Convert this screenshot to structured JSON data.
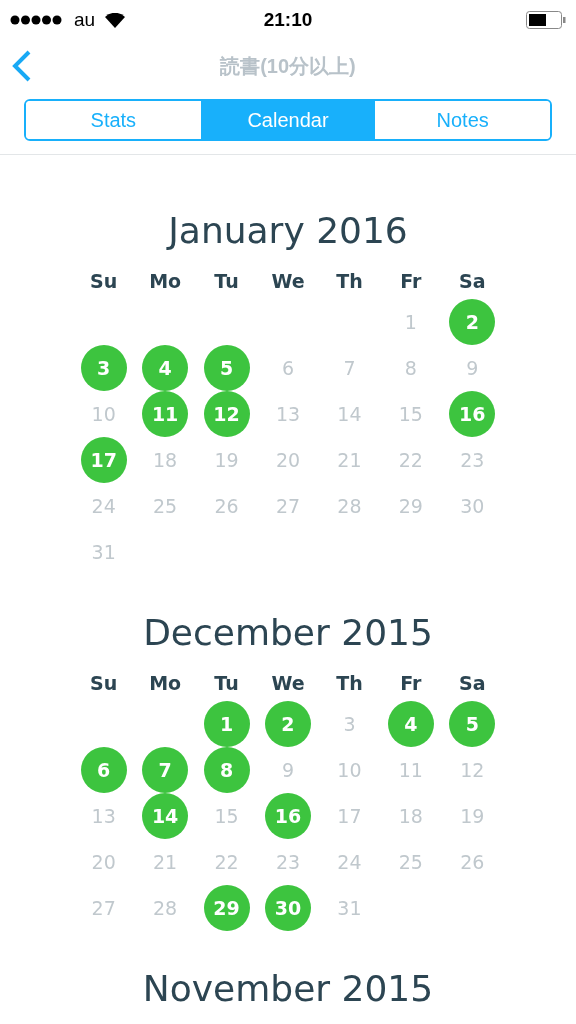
{
  "status_bar": {
    "carrier": "au",
    "time": "21:10"
  },
  "nav": {
    "title": "読書(10分以上)"
  },
  "tabs": [
    {
      "label": "Stats",
      "selected": false
    },
    {
      "label": "Calendar",
      "selected": true
    },
    {
      "label": "Notes",
      "selected": false
    }
  ],
  "months": [
    {
      "title": "January 2016",
      "weekdays": [
        "Su",
        "Mo",
        "Tu",
        "We",
        "Th",
        "Fr",
        "Sa"
      ],
      "days": [
        {
          "kind": "blank"
        },
        {
          "kind": "blank"
        },
        {
          "kind": "blank"
        },
        {
          "kind": "blank"
        },
        {
          "kind": "blank"
        },
        {
          "kind": "day",
          "label": "1",
          "done": false
        },
        {
          "kind": "day",
          "label": "2",
          "done": true
        },
        {
          "kind": "day",
          "label": "3",
          "done": true
        },
        {
          "kind": "day",
          "label": "4",
          "done": true
        },
        {
          "kind": "day",
          "label": "5",
          "done": true
        },
        {
          "kind": "day",
          "label": "6",
          "done": false
        },
        {
          "kind": "day",
          "label": "7",
          "done": false
        },
        {
          "kind": "day",
          "label": "8",
          "done": false
        },
        {
          "kind": "day",
          "label": "9",
          "done": false
        },
        {
          "kind": "day",
          "label": "10",
          "done": false
        },
        {
          "kind": "day",
          "label": "11",
          "done": true
        },
        {
          "kind": "day",
          "label": "12",
          "done": true
        },
        {
          "kind": "day",
          "label": "13",
          "done": false
        },
        {
          "kind": "day",
          "label": "14",
          "done": false
        },
        {
          "kind": "day",
          "label": "15",
          "done": false
        },
        {
          "kind": "day",
          "label": "16",
          "done": true
        },
        {
          "kind": "day",
          "label": "17",
          "done": true
        },
        {
          "kind": "day",
          "label": "18",
          "done": false
        },
        {
          "kind": "day",
          "label": "19",
          "done": false
        },
        {
          "kind": "day",
          "label": "20",
          "done": false
        },
        {
          "kind": "day",
          "label": "21",
          "done": false
        },
        {
          "kind": "day",
          "label": "22",
          "done": false
        },
        {
          "kind": "day",
          "label": "23",
          "done": false
        },
        {
          "kind": "day",
          "label": "24",
          "done": false
        },
        {
          "kind": "day",
          "label": "25",
          "done": false
        },
        {
          "kind": "day",
          "label": "26",
          "done": false
        },
        {
          "kind": "day",
          "label": "27",
          "done": false
        },
        {
          "kind": "day",
          "label": "28",
          "done": false
        },
        {
          "kind": "day",
          "label": "29",
          "done": false
        },
        {
          "kind": "day",
          "label": "30",
          "done": false
        },
        {
          "kind": "day",
          "label": "31",
          "done": false
        }
      ]
    },
    {
      "title": "December 2015",
      "weekdays": [
        "Su",
        "Mo",
        "Tu",
        "We",
        "Th",
        "Fr",
        "Sa"
      ],
      "days": [
        {
          "kind": "blank"
        },
        {
          "kind": "blank"
        },
        {
          "kind": "day",
          "label": "1",
          "done": true
        },
        {
          "kind": "day",
          "label": "2",
          "done": true
        },
        {
          "kind": "day",
          "label": "3",
          "done": false
        },
        {
          "kind": "day",
          "label": "4",
          "done": true
        },
        {
          "kind": "day",
          "label": "5",
          "done": true
        },
        {
          "kind": "day",
          "label": "6",
          "done": true
        },
        {
          "kind": "day",
          "label": "7",
          "done": true
        },
        {
          "kind": "day",
          "label": "8",
          "done": true
        },
        {
          "kind": "day",
          "label": "9",
          "done": false
        },
        {
          "kind": "day",
          "label": "10",
          "done": false
        },
        {
          "kind": "day",
          "label": "11",
          "done": false
        },
        {
          "kind": "day",
          "label": "12",
          "done": false
        },
        {
          "kind": "day",
          "label": "13",
          "done": false
        },
        {
          "kind": "day",
          "label": "14",
          "done": true
        },
        {
          "kind": "day",
          "label": "15",
          "done": false
        },
        {
          "kind": "day",
          "label": "16",
          "done": true
        },
        {
          "kind": "day",
          "label": "17",
          "done": false
        },
        {
          "kind": "day",
          "label": "18",
          "done": false
        },
        {
          "kind": "day",
          "label": "19",
          "done": false
        },
        {
          "kind": "day",
          "label": "20",
          "done": false
        },
        {
          "kind": "day",
          "label": "21",
          "done": false
        },
        {
          "kind": "day",
          "label": "22",
          "done": false
        },
        {
          "kind": "day",
          "label": "23",
          "done": false
        },
        {
          "kind": "day",
          "label": "24",
          "done": false
        },
        {
          "kind": "day",
          "label": "25",
          "done": false
        },
        {
          "kind": "day",
          "label": "26",
          "done": false
        },
        {
          "kind": "day",
          "label": "27",
          "done": false
        },
        {
          "kind": "day",
          "label": "28",
          "done": false
        },
        {
          "kind": "day",
          "label": "29",
          "done": true
        },
        {
          "kind": "day",
          "label": "30",
          "done": true
        },
        {
          "kind": "day",
          "label": "31",
          "done": false
        }
      ]
    },
    {
      "title": "November 2015"
    }
  ]
}
